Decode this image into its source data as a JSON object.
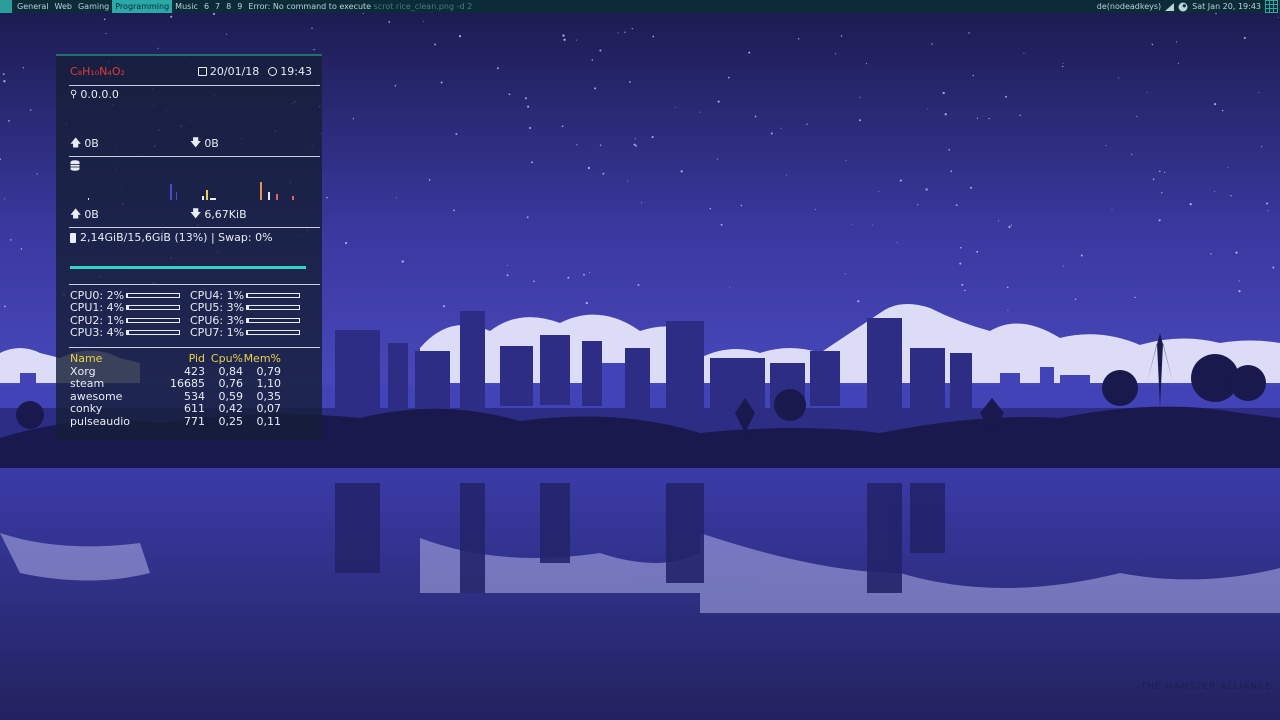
{
  "topbar": {
    "tags": [
      {
        "label": "General",
        "active": false
      },
      {
        "label": "Web",
        "active": false
      },
      {
        "label": "Gaming",
        "active": false
      },
      {
        "label": "Programming",
        "active": true
      },
      {
        "label": "Music",
        "active": false
      },
      {
        "label": "6",
        "active": false
      },
      {
        "label": "7",
        "active": false
      },
      {
        "label": "8",
        "active": false
      },
      {
        "label": "9",
        "active": false
      }
    ],
    "error_prefix": "Error: No command to execute",
    "error_cmd": "scrot rice_clean.png -d 2",
    "keyboard_layout": "de(nodeadkeys)",
    "clock": "Sat Jan 20, 19:43"
  },
  "conky": {
    "formula": "C₈H₁₀N₄O₂",
    "date": "20/01/18",
    "time": "19:43",
    "ip": "0.0.0.0",
    "net_up": "0B",
    "net_down": "0B",
    "disk_read": "0B",
    "disk_write": "6,67KiB",
    "memory": "2,14GiB/15,6GiB (13%) | Swap: 0%",
    "memory_fraction": 0.13,
    "cpus": [
      {
        "label": "CPU0: 2%",
        "value": 2
      },
      {
        "label": "CPU1: 4%",
        "value": 4
      },
      {
        "label": "CPU2: 1%",
        "value": 1
      },
      {
        "label": "CPU3: 4%",
        "value": 4
      },
      {
        "label": "CPU4: 1%",
        "value": 1
      },
      {
        "label": "CPU5: 3%",
        "value": 3
      },
      {
        "label": "CPU6: 3%",
        "value": 3
      },
      {
        "label": "CPU7: 1%",
        "value": 1
      }
    ],
    "proc_headers": [
      "Name",
      "Pid",
      "Cpu%",
      "Mem%"
    ],
    "processes": [
      [
        "Xorg",
        "423",
        "0,84",
        "0,79"
      ],
      [
        "steam",
        "16685",
        "0,76",
        "1,10"
      ],
      [
        "awesome",
        "534",
        "0,59",
        "0,35"
      ],
      [
        "conky",
        "611",
        "0,42",
        "0,07"
      ],
      [
        "pulseaudio",
        "771",
        "0,25",
        "0,11"
      ]
    ]
  },
  "wallpaper": {
    "watermark": "THE HAMSTER ALLIANCE"
  },
  "colors": {
    "topbar_bg": "#0b2b38",
    "accent": "#2ba8a8",
    "formula": "#e23a3a",
    "proc_header": "#e9d245",
    "mem_bar": "#2fd6c8"
  }
}
